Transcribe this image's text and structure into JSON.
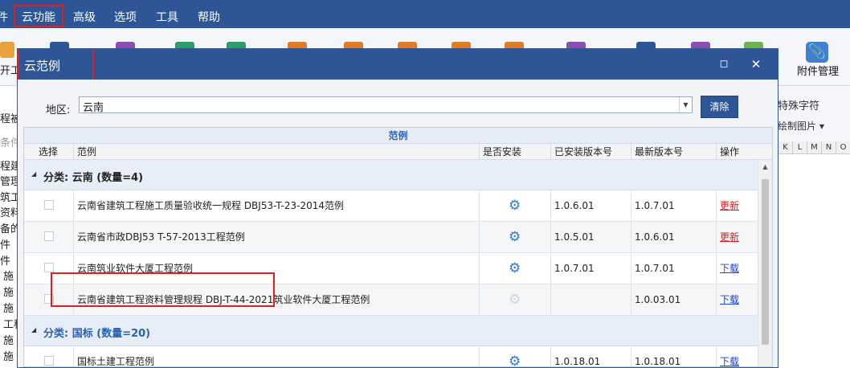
{
  "menu": {
    "items": [
      "件",
      "云功能",
      "高级",
      "选项",
      "工具",
      "帮助"
    ]
  },
  "ribbon": {
    "open_label": "开工",
    "clip_icon": "paperclip-icon",
    "attachment_label": "附件管理",
    "special_chars_label": "特殊字符",
    "draw_image_label": "绘制图片 ▾"
  },
  "sidebar": {
    "items": [
      "程被",
      "条件",
      "程建",
      "管理",
      "筑工",
      "资料",
      "备的",
      "件",
      "件",
      "施",
      "施",
      "施",
      "工程",
      "施",
      "施"
    ]
  },
  "sheet": {
    "columns": [
      "K",
      "L",
      "M",
      "N",
      "O"
    ]
  },
  "dialog": {
    "title": "云范例",
    "maximize_icon": "maximize-icon",
    "close_icon": "close-icon",
    "region_label": "地区:",
    "region_value": "云南",
    "clear_label": "清除",
    "grid_caption": "范例",
    "columns": {
      "select": "选择",
      "example": "范例",
      "installed": "是否安装",
      "installed_version": "已安装版本号",
      "latest_version": "最新版本号",
      "action": "操作"
    },
    "groups": [
      {
        "label": "分类: 云南 (数量=4)",
        "label_color": "#222222",
        "rows": [
          {
            "name": "云南省建筑工程施工质量验收统一规程 DBJ53-T-23-2014范例",
            "installed": true,
            "installed_version": "1.0.6.01",
            "latest_version": "1.0.7.01",
            "action": "更新"
          },
          {
            "name": "云南省市政DBJ53 T-57-2013工程范例",
            "installed": true,
            "installed_version": "1.0.5.01",
            "latest_version": "1.0.6.01",
            "action": "更新"
          },
          {
            "name": "云南筑业软件大厦工程范例",
            "installed": true,
            "installed_version": "1.0.7.01",
            "latest_version": "1.0.7.01",
            "action": "下载"
          },
          {
            "name": "云南省建筑工程资料管理规程 DBJ-T-44-2021筑业软件大厦工程范例",
            "installed": false,
            "installed_version": "",
            "latest_version": "1.0.03.01",
            "action": "下载"
          }
        ]
      },
      {
        "label": "分类: 国标 (数量=20)",
        "label_color": "#2862b6",
        "rows": [
          {
            "name": "国标土建工程范例",
            "installed": true,
            "installed_version": "1.0.18.01",
            "latest_version": "1.0.18.01",
            "action": "下载"
          }
        ]
      }
    ]
  }
}
